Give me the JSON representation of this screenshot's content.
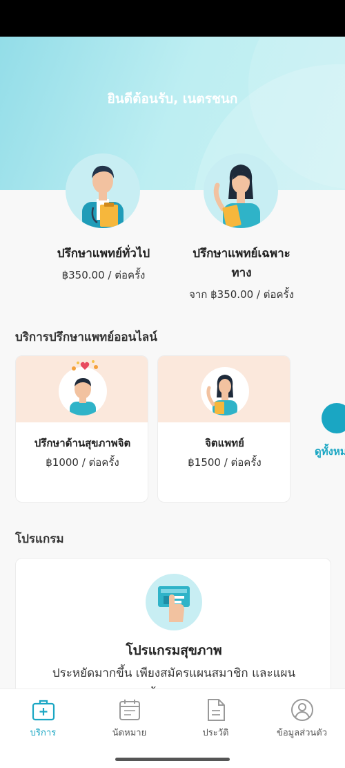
{
  "header": {
    "greeting": "ยินดีต้อนรับ, เนตรชนก"
  },
  "consult_options": [
    {
      "title": "ปรึกษาแพทย์ทั่วไป",
      "price": "฿350.00 / ต่อครั้ง"
    },
    {
      "title_line1": "ปรึกษาแพทย์เฉพาะ",
      "title_line2": "ทาง",
      "price": "จาก ฿350.00 / ต่อครั้ง"
    }
  ],
  "online_services": {
    "heading": "บริการปรึกษาแพทย์ออนไลน์",
    "items": [
      {
        "title": "ปรึกษาด้านสุขภาพจิต",
        "price": "฿1000 / ต่อครั้ง"
      },
      {
        "title": "จิตแพทย์",
        "price": "฿1500 / ต่อครั้ง"
      }
    ],
    "see_all": "ดูทั้งหมด"
  },
  "programs": {
    "heading": "โปรแกรม",
    "card_title": "โปรแกรมสุขภาพ",
    "card_desc_line1": "ประหยัดมากขึ้น เพียงสมัครแผนสมาชิก และแผน",
    "card_desc_line2": "ความคุ้มครองของเรา"
  },
  "tabbar": {
    "items": [
      {
        "label": "บริการ",
        "icon": "medical-bag-icon",
        "active": true
      },
      {
        "label": "นัดหมาย",
        "icon": "calendar-icon",
        "active": false
      },
      {
        "label": "ประวัติ",
        "icon": "document-icon",
        "active": false
      },
      {
        "label": "ข้อมูลส่วนตัว",
        "icon": "profile-icon",
        "active": false
      }
    ]
  },
  "colors": {
    "accent": "#1aa6c3",
    "hero": "#a8e6ee",
    "service_card_top": "#fbe8dc"
  }
}
